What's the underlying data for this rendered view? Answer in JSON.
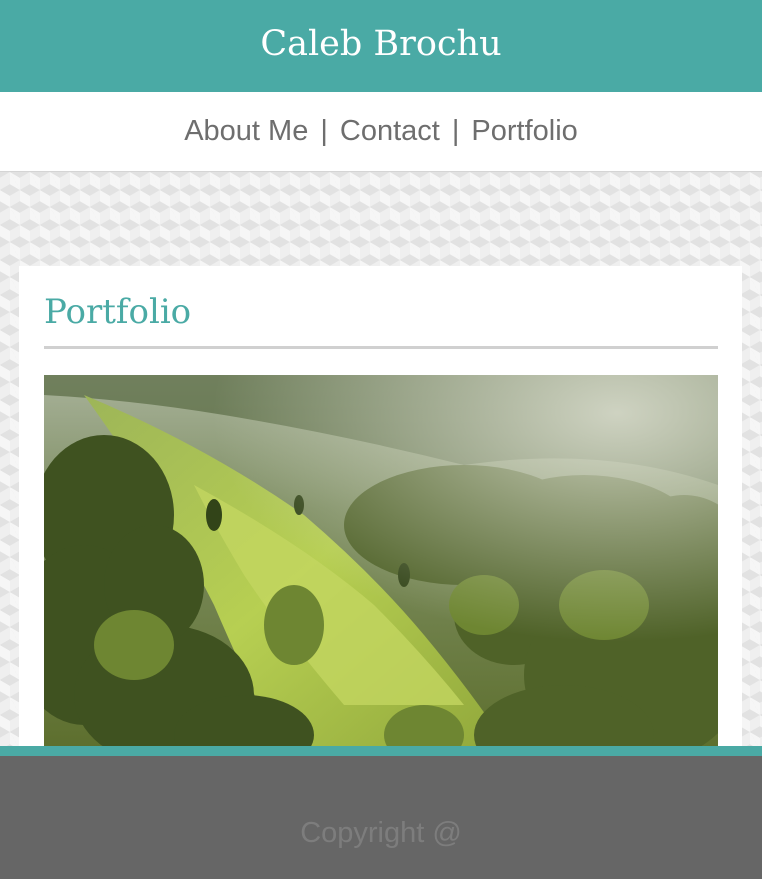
{
  "header": {
    "site_title": "Caleb Brochu",
    "background": "#4aaaa5"
  },
  "nav": {
    "items": [
      {
        "label": "About Me"
      },
      {
        "label": "Contact"
      },
      {
        "label": "Portfolio"
      }
    ],
    "separator": "|"
  },
  "main": {
    "section_title": "Portfolio",
    "accent": "#4aaaa5"
  },
  "footer": {
    "copyright": "Copyright @",
    "background": "#666666"
  }
}
